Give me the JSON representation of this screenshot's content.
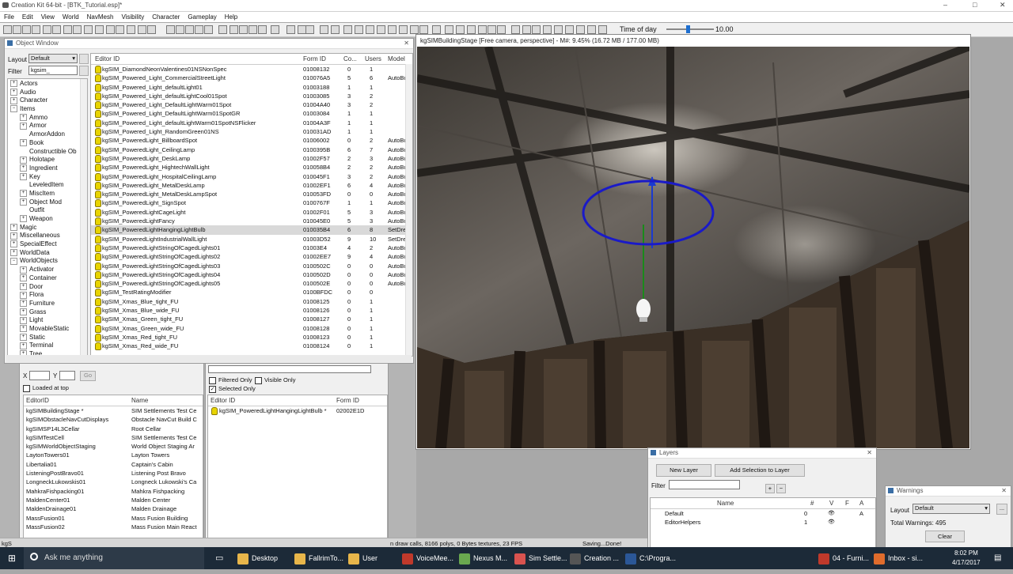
{
  "app": {
    "title": "Creation Kit 64-bit - [BTK_Tutorial.esp]*",
    "window_controls": [
      "–",
      "□",
      "✕"
    ]
  },
  "menu": [
    "File",
    "Edit",
    "View",
    "World",
    "NavMesh",
    "Visibility",
    "Character",
    "Gameplay",
    "Help"
  ],
  "toolbar": {
    "time_of_day_label": "Time of day",
    "time_of_day_value": "10.00",
    "time_of_day_fraction": 0.45
  },
  "object_window": {
    "title": "Object Window",
    "layout_label": "Layout",
    "layout_value": "Default",
    "filter_label": "Filter",
    "filter_value": "kgsim_",
    "tree": [
      {
        "label": "Actors",
        "pm": "+",
        "indent": 0
      },
      {
        "label": "Audio",
        "pm": "+",
        "indent": 0
      },
      {
        "label": "Character",
        "pm": "+",
        "indent": 0
      },
      {
        "label": "Items",
        "pm": "−",
        "indent": 0
      },
      {
        "label": "Ammo",
        "pm": "+",
        "indent": 1
      },
      {
        "label": "Armor",
        "pm": "+",
        "indent": 1
      },
      {
        "label": "ArmorAddon",
        "pm": "",
        "indent": 1
      },
      {
        "label": "Book",
        "pm": "+",
        "indent": 1
      },
      {
        "label": "Constructible Ob",
        "pm": "",
        "indent": 1
      },
      {
        "label": "Holotape",
        "pm": "+",
        "indent": 1
      },
      {
        "label": "Ingredient",
        "pm": "+",
        "indent": 1
      },
      {
        "label": "Key",
        "pm": "+",
        "indent": 1
      },
      {
        "label": "LeveledItem",
        "pm": "",
        "indent": 1
      },
      {
        "label": "MiscItem",
        "pm": "+",
        "indent": 1
      },
      {
        "label": "Object Mod",
        "pm": "+",
        "indent": 1
      },
      {
        "label": "Outfit",
        "pm": "",
        "indent": 1
      },
      {
        "label": "Weapon",
        "pm": "+",
        "indent": 1
      },
      {
        "label": "Magic",
        "pm": "+",
        "indent": 0
      },
      {
        "label": "Miscellaneous",
        "pm": "+",
        "indent": 0
      },
      {
        "label": "SpecialEffect",
        "pm": "+",
        "indent": 0
      },
      {
        "label": "WorldData",
        "pm": "+",
        "indent": 0
      },
      {
        "label": "WorldObjects",
        "pm": "−",
        "indent": 0
      },
      {
        "label": "Activator",
        "pm": "+",
        "indent": 1
      },
      {
        "label": "Container",
        "pm": "+",
        "indent": 1
      },
      {
        "label": "Door",
        "pm": "+",
        "indent": 1
      },
      {
        "label": "Flora",
        "pm": "+",
        "indent": 1
      },
      {
        "label": "Furniture",
        "pm": "+",
        "indent": 1
      },
      {
        "label": "Grass",
        "pm": "+",
        "indent": 1
      },
      {
        "label": "Light",
        "pm": "+",
        "indent": 1
      },
      {
        "label": "MovableStatic",
        "pm": "+",
        "indent": 1
      },
      {
        "label": "Static",
        "pm": "+",
        "indent": 1
      },
      {
        "label": "Terminal",
        "pm": "+",
        "indent": 1
      },
      {
        "label": "Tree",
        "pm": "+",
        "indent": 1
      }
    ],
    "columns": [
      "Editor ID",
      "Form ID",
      "Co...",
      "Users",
      "Model"
    ],
    "rows": [
      {
        "id": "kgSIM_DiamondNeonValentines01NSNonSpec",
        "form": "01008132",
        "c": "0",
        "u": "1",
        "m": ""
      },
      {
        "id": "kgSIM_Powered_Light_CommercialStreetLight",
        "form": "010076A5",
        "c": "5",
        "u": "6",
        "m": "AutoBu"
      },
      {
        "id": "kgSIM_Powered_Light_defaultLight01",
        "form": "01003188",
        "c": "1",
        "u": "1",
        "m": ""
      },
      {
        "id": "kgSIM_Powered_Light_defaultLightCool01Spot",
        "form": "01003085",
        "c": "3",
        "u": "2",
        "m": ""
      },
      {
        "id": "kgSIM_Powered_Light_DefaultLightWarm01Spot",
        "form": "01004A40",
        "c": "3",
        "u": "2",
        "m": ""
      },
      {
        "id": "kgSIM_Powered_Light_DefaultLightWarm01SpotGR",
        "form": "01003084",
        "c": "1",
        "u": "1",
        "m": ""
      },
      {
        "id": "kgSIM_Powered_Light_defaultLightWarm01SpotNSFlicker",
        "form": "01004A3F",
        "c": "1",
        "u": "1",
        "m": ""
      },
      {
        "id": "kgSIM_Powered_Light_RandomGreen01NS",
        "form": "010031AD",
        "c": "1",
        "u": "1",
        "m": ""
      },
      {
        "id": "kgSIM_PoweredLight_BillboardSpot",
        "form": "01006002",
        "c": "0",
        "u": "2",
        "m": "AutoBu"
      },
      {
        "id": "kgSIM_PoweredLight_CeilingLamp",
        "form": "0100395B",
        "c": "6",
        "u": "7",
        "m": "AutoBu"
      },
      {
        "id": "kgSIM_PoweredLight_DeskLamp",
        "form": "01002F57",
        "c": "2",
        "u": "3",
        "m": "AutoBu"
      },
      {
        "id": "kgSIM_PoweredLight_HightechWallLight",
        "form": "010058B4",
        "c": "2",
        "u": "2",
        "m": "AutoBu"
      },
      {
        "id": "kgSIM_PoweredLight_HospitalCeilingLamp",
        "form": "010045F1",
        "c": "3",
        "u": "2",
        "m": "AutoBu"
      },
      {
        "id": "kgSIM_PoweredLight_MetalDeskLamp",
        "form": "01002EF1",
        "c": "6",
        "u": "4",
        "m": "AutoBu"
      },
      {
        "id": "kgSIM_PoweredLight_MetalDeskLampSpot",
        "form": "010053FD",
        "c": "0",
        "u": "0",
        "m": "AutoBu"
      },
      {
        "id": "kgSIM_PoweredLight_SignSpot",
        "form": "0100767F",
        "c": "1",
        "u": "1",
        "m": "AutoBu"
      },
      {
        "id": "kgSIM_PoweredLightCageLight",
        "form": "01002F01",
        "c": "5",
        "u": "3",
        "m": "AutoBu"
      },
      {
        "id": "kgSIM_PoweredLightFancy",
        "form": "010045E0",
        "c": "5",
        "u": "3",
        "m": "AutoBu"
      },
      {
        "id": "kgSIM_PoweredLightHangingLightBulb",
        "form": "010035B4",
        "c": "6",
        "u": "8",
        "m": "SetDre"
      },
      {
        "id": "kgSIM_PoweredLightIndustrialWallLight",
        "form": "01003D52",
        "c": "9",
        "u": "10",
        "m": "SetDre"
      },
      {
        "id": "kgSIM_PoweredLightStringOfCagedLights01",
        "form": "01003E4",
        "c": "4",
        "u": "2",
        "m": "AutoBu"
      },
      {
        "id": "kgSIM_PoweredLightStringOfCagedLights02",
        "form": "01002EE7",
        "c": "9",
        "u": "4",
        "m": "AutoBu"
      },
      {
        "id": "kgSIM_PoweredLightStringOfCagedLights03",
        "form": "0100502C",
        "c": "0",
        "u": "0",
        "m": "AutoBu"
      },
      {
        "id": "kgSIM_PoweredLightStringOfCagedLights04",
        "form": "0100502D",
        "c": "0",
        "u": "0",
        "m": "AutoBu"
      },
      {
        "id": "kgSIM_PoweredLightStringOfCagedLights05",
        "form": "0100502E",
        "c": "0",
        "u": "0",
        "m": "AutoBu"
      },
      {
        "id": "kgSIM_TestRatingModifier",
        "form": "0100BFDC",
        "c": "0",
        "u": "0",
        "m": ""
      },
      {
        "id": "kgSIM_Xmas_Blue_tight_FU",
        "form": "01008125",
        "c": "0",
        "u": "1",
        "m": ""
      },
      {
        "id": "kgSIM_Xmas_Blue_wide_FU",
        "form": "01008126",
        "c": "0",
        "u": "1",
        "m": ""
      },
      {
        "id": "kgSIM_Xmas_Green_tight_FU",
        "form": "01008127",
        "c": "0",
        "u": "1",
        "m": ""
      },
      {
        "id": "kgSIM_Xmas_Green_wide_FU",
        "form": "01008128",
        "c": "0",
        "u": "1",
        "m": ""
      },
      {
        "id": "kgSIM_Xmas_Red_tight_FU",
        "form": "01008123",
        "c": "0",
        "u": "1",
        "m": ""
      },
      {
        "id": "kgSIM_Xmas_Red_wide_FU",
        "form": "01008124",
        "c": "0",
        "u": "1",
        "m": ""
      }
    ],
    "selected_index": 18
  },
  "render_window": {
    "title": "kgSIMBuildingStage [Free camera, perspective] - M#: 9.45% (16.72 MB / 177.00 MB)"
  },
  "cell_view": {
    "x_label": "X",
    "y_label": "Y",
    "go_label": "Go",
    "loaded_at_top": "Loaded at top",
    "columns": [
      "EditorID",
      "Name"
    ],
    "rows": [
      {
        "id": "kgSIMBuildingStage *",
        "name": "SIM Settlements Test Ce"
      },
      {
        "id": "kgSIMObstacleNavCutDisplays",
        "name": "Obstacle NavCut Build C"
      },
      {
        "id": "kgSIMSP14L3Cellar",
        "name": "Root Cellar"
      },
      {
        "id": "kgSIMTestCell",
        "name": "SIM Settlements Test Ce"
      },
      {
        "id": "kgSIMWorldObjectStaging",
        "name": "World Object Staging Ar"
      },
      {
        "id": "LaytonTowers01",
        "name": "Layton Towers"
      },
      {
        "id": "Libertalia01",
        "name": "Captain's Cabin"
      },
      {
        "id": "ListeningPostBravo01",
        "name": "Listening Post Bravo"
      },
      {
        "id": "LongneckLukowskis01",
        "name": "Longneck Lukowski's Ca"
      },
      {
        "id": "MahkraFishpacking01",
        "name": "Mahkra Fishpacking"
      },
      {
        "id": "MaldenCenter01",
        "name": "Malden Center"
      },
      {
        "id": "MaldenDrainage01",
        "name": "Malden Drainage"
      },
      {
        "id": "MassFusion01",
        "name": "Mass Fusion Building"
      },
      {
        "id": "MassFusion02",
        "name": "Mass Fusion Main React"
      }
    ]
  },
  "cell_objects": {
    "filtered_only": "Filtered Only",
    "visible_only": "Visible Only",
    "selected_only": "Selected Only",
    "columns": [
      "Editor ID",
      "Form ID"
    ],
    "rows": [
      {
        "id": "kgSIM_PoweredLightHangingLightBulb *",
        "form": "02002E1D"
      }
    ]
  },
  "layers": {
    "title": "Layers",
    "new_layer": "New Layer",
    "add_selection": "Add Selection to Layer",
    "filter_label": "Filter",
    "plus": "+",
    "minus": "−",
    "columns": [
      "Name",
      "#",
      "V",
      "F",
      "A"
    ],
    "rows": [
      {
        "name": "Default",
        "count": "0",
        "v": "👁",
        "a": "A"
      },
      {
        "name": "EditorHelpers",
        "count": "1",
        "v": "👁",
        "a": ""
      }
    ]
  },
  "warnings": {
    "title": "Warnings",
    "layout_label": "Layout",
    "layout_value": "Default",
    "total": "Total Warnings: 495",
    "clear": "Clear",
    "more": "..."
  },
  "statusbar": {
    "left": "kgS",
    "middle": "n draw calls, 8166 polys, 0 Bytes textures, 23 FPS",
    "right": "Saving...Done!"
  },
  "taskbar": {
    "search": "Ask me anything",
    "items": [
      "Desktop",
      "FallrimTo...",
      "User",
      "VoiceMee...",
      "Nexus M...",
      "Sim Settle...",
      "Creation ...",
      "C:\\Progra...",
      "04 - Furni...",
      "Inbox - si..."
    ],
    "time": "8:02 PM",
    "date": "4/17/2017"
  }
}
